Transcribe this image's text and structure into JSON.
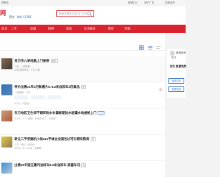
{
  "topbar": {
    "left": "请登录",
    "right": [
      "客服中心",
      "用户广告",
      "招商合作"
    ]
  },
  "header": {
    "logo": "网",
    "city_prefix": "您在：",
    "city": "湖南",
    "city_switch": "【切换】",
    "search_placeholder": "搜索关键词 可找 如 \"手机\""
  },
  "nav": [
    "首页",
    "二手",
    "房屋",
    "招聘",
    "家政",
    "生活服务",
    "教育",
    "车辆"
  ],
  "listings": [
    {
      "title": "发方市八单电脑上门维修",
      "tag": "推荐",
      "meta1": "1 田 · 八供各种",
      "meta2": "4 单 维修售后 · 2 万人看",
      "meta3": "",
      "price": ""
    },
    {
      "title": "特价出售23年4月款最大G 8.2米自卸车2匹高品",
      "tag": "推",
      "meta1": "八供各种 · 3 方",
      "meta2": "",
      "meta3": "3.3 万 · 可议价",
      "price": "价"
    },
    {
      "title": "东方地区卫生间不砸砖防水补漏修复防水层漏水电维修上门",
      "tag": "上门",
      "meta1": "3.6 万 · 2 1 · 全城 · 专业防水工 · 已完成",
      "meta2": "",
      "meta3": "",
      "price": ""
    },
    {
      "title": "转让二手挖掘机小松240手续全全国包过可分期有质保",
      "tag": "推",
      "meta1": "1 方 · 转让 · 可议价 ·",
      "meta2": "3.5 台 · 5.1 10 台 · 无事故 ·",
      "meta3": "",
      "price": ""
    },
    {
      "title": "出售20年国五重汽油排车8.2米自卸车 质量车况",
      "tag": "推",
      "meta1": "",
      "meta2": "",
      "meta3": "",
      "price": ""
    }
  ],
  "sidebar": {
    "label1": "请选发布",
    "label2": "发方",
    "label3": "发方 房屋免费",
    "button1": "免费发布",
    "button2": "管理信息"
  },
  "colors": {
    "brand": "#d9232e",
    "link": "#3b77c9"
  }
}
